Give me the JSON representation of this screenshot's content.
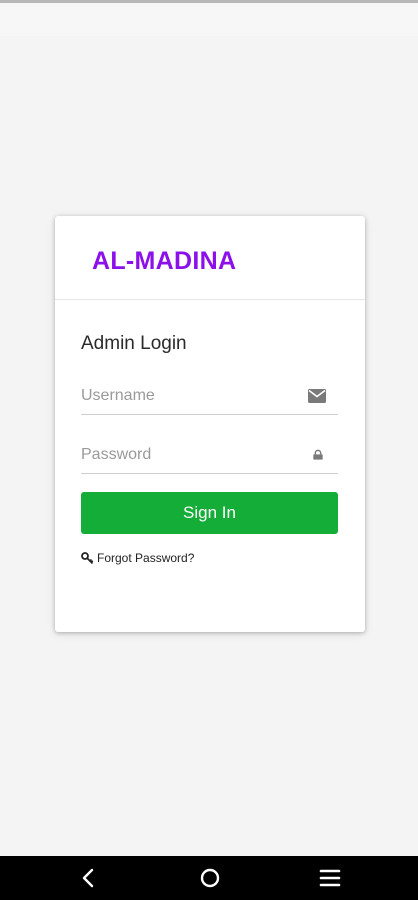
{
  "app": {
    "brand": "AL-MADINA",
    "brand_color": "#8b10ea"
  },
  "login": {
    "title": "Admin Login",
    "username_placeholder": "Username",
    "username_value": "",
    "username_icon": "envelope-icon",
    "password_placeholder": "Password",
    "password_value": "",
    "password_icon": "lock-icon",
    "sign_in_label": "Sign In",
    "sign_in_color": "#14ad38",
    "forgot_label": "Forgot Password?",
    "forgot_icon": "key-icon"
  },
  "nav": {
    "back_icon": "back-chevron-icon",
    "home_icon": "home-circle-icon",
    "menu_icon": "menu-lines-icon"
  }
}
